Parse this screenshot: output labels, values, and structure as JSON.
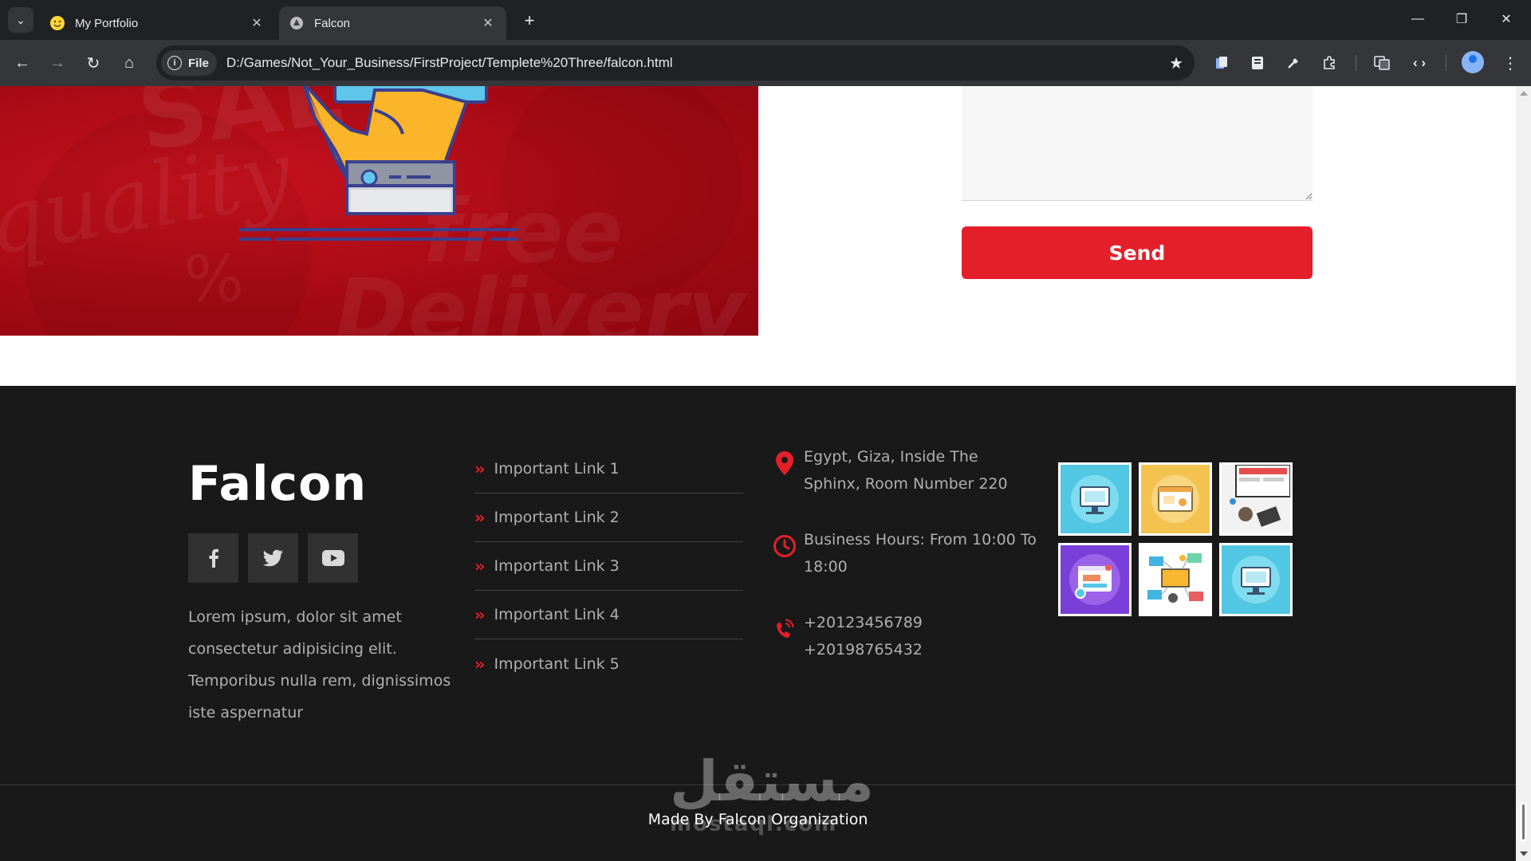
{
  "browser": {
    "tabs": [
      {
        "title": "My Portfolio",
        "favicon": "smiley-icon",
        "active": false
      },
      {
        "title": "Falcon",
        "favicon": "falcon-icon",
        "active": true
      }
    ],
    "site_chip": "File",
    "url": "D:/Games/Not_Your_Business/FirstProject/Templete%20Three/falcon.html"
  },
  "contact": {
    "send_label": "Send"
  },
  "footer": {
    "brand": "Falcon",
    "socials": [
      "facebook-icon",
      "twitter-icon",
      "youtube-icon"
    ],
    "about": "Lorem ipsum, dolor sit amet consectetur adipisicing elit. Temporibus nulla rem, dignissimos iste aspernatur",
    "links": [
      "Important Link 1",
      "Important Link 2",
      "Important Link 3",
      "Important Link 4",
      "Important Link 5"
    ],
    "address": "Egypt, Giza, Inside The Sphinx, Room Number 220",
    "hours": "Business Hours: From 10:00 To 18:00",
    "phones": [
      "+20123456789",
      "+20198765432"
    ],
    "copyright": "Made By Falcon Organization"
  },
  "watermark": {
    "arabic": "مستقل",
    "latin": "mostaql.com"
  },
  "colors": {
    "accent": "#e51f2a",
    "footer_bg": "#191919"
  }
}
